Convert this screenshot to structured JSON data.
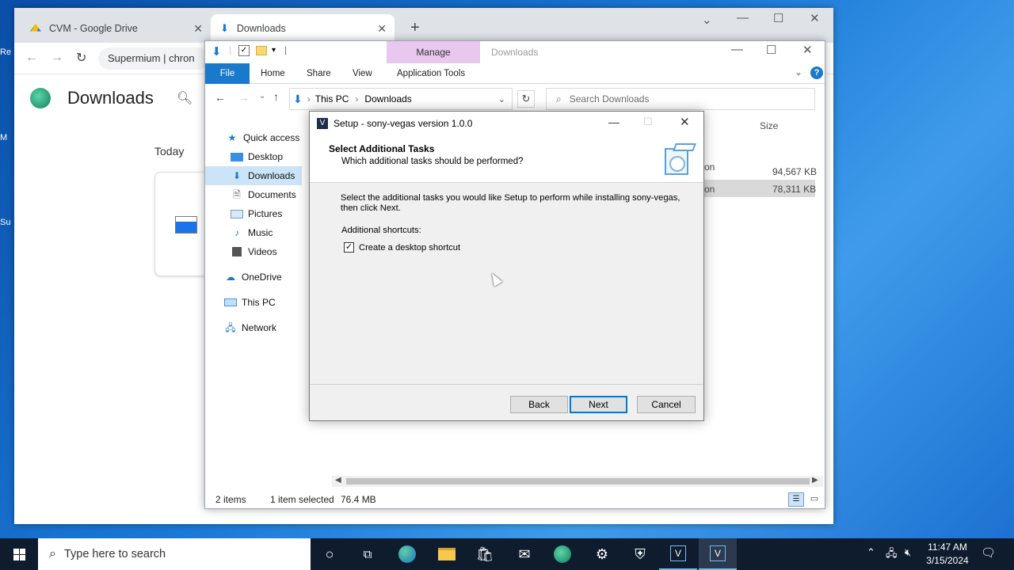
{
  "desktop": {
    "stubs": [
      "Re",
      "M",
      "Su"
    ]
  },
  "browser": {
    "tabs": [
      {
        "label": "CVM - Google Drive",
        "active": false
      },
      {
        "label": "Downloads",
        "active": true
      }
    ],
    "new_tab_symbol": "+",
    "address_text": "Supermium | chron",
    "page_title": "Downloads",
    "section_label": "Today"
  },
  "explorer": {
    "manage_label": "Manage",
    "title_text": "Downloads",
    "ribbon_tabs": [
      "File",
      "Home",
      "Share",
      "View",
      "Application Tools"
    ],
    "breadcrumb": [
      "This PC",
      "Downloads"
    ],
    "search_placeholder": "Search Downloads",
    "nav_items": [
      {
        "label": "Quick access",
        "icon": "star-icon",
        "selected": false
      },
      {
        "label": "Desktop",
        "icon": "desktop-folder-icon",
        "selected": false
      },
      {
        "label": "Downloads",
        "icon": "download-arrow-icon",
        "selected": true
      },
      {
        "label": "Documents",
        "icon": "document-icon",
        "selected": false
      },
      {
        "label": "Pictures",
        "icon": "pictures-icon",
        "selected": false
      },
      {
        "label": "Music",
        "icon": "music-note-icon",
        "selected": false
      },
      {
        "label": "Videos",
        "icon": "film-icon",
        "selected": false
      },
      {
        "label": "OneDrive",
        "icon": "cloud-icon",
        "selected": false
      },
      {
        "label": "This PC",
        "icon": "computer-icon",
        "selected": false
      },
      {
        "label": "Network",
        "icon": "network-icon",
        "selected": false
      }
    ],
    "size_header": "Size",
    "rows": [
      {
        "type_fragment": "on",
        "size": "94,567 KB",
        "selected": false
      },
      {
        "type_fragment": "on",
        "size": "78,311 KB",
        "selected": true
      }
    ],
    "status": {
      "count": "2 items",
      "selection": "1 item selected",
      "size": "76.4 MB"
    }
  },
  "dialog": {
    "title": "Setup - sony-vegas version 1.0.0",
    "heading": "Select Additional Tasks",
    "subheading": "Which additional tasks should be performed?",
    "instruction": "Select the additional tasks you would like Setup to perform while installing sony-vegas, then click Next.",
    "group_label": "Additional shortcuts:",
    "checkbox_label": "Create a desktop shortcut",
    "checkbox_checked": true,
    "buttons": {
      "back": "Back",
      "next": "Next",
      "cancel": "Cancel"
    }
  },
  "taskbar": {
    "search_placeholder": "Type here to search",
    "time": "11:47 AM",
    "date": "3/15/2024"
  },
  "colors": {
    "accent": "#1979ca",
    "manage_tab": "#e8c8ef",
    "selection": "#cce4f7",
    "taskbar": "#0f1c2e"
  }
}
